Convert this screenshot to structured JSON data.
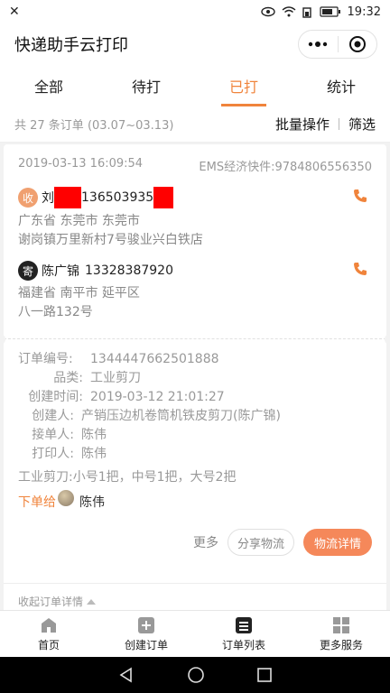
{
  "statusbar": {
    "time": "19:32"
  },
  "app": {
    "title": "快递助手云打印"
  },
  "tabs": [
    {
      "label": "全部"
    },
    {
      "label": "待打"
    },
    {
      "label": "已打"
    },
    {
      "label": "统计"
    }
  ],
  "active_tab": "已打",
  "summary": {
    "count": "共 27 条订单 (03.07~03.13)",
    "batch": "批量操作",
    "filter": "筛选"
  },
  "order": {
    "time": "2019-03-13 16:09:54",
    "tracking": "EMS经济快件:9784806556350",
    "receiver": {
      "badge": "收",
      "name": "刘",
      "phone": "136503935",
      "addr1": "广东省 东莞市 东莞市",
      "addr2": "谢岗镇万里新村7号骏业兴白铁店"
    },
    "sender": {
      "badge": "寄",
      "name": "陈广锦",
      "phone": "13328387920",
      "addr1": "福建省 南平市 延平区",
      "addr2": "八一路132号"
    },
    "details": {
      "order_no_label": "订单编号:",
      "order_no": "1344447662501888",
      "category_label": "品类:",
      "category": "工业剪刀",
      "created_label": "创建时间:",
      "created": "2019-03-12 21:01:27",
      "creator_label": "创建人:",
      "creator": "产销压边机卷筒机铁皮剪刀(陈广锦)",
      "receiver_label": "接单人:",
      "receiver": "陈伟",
      "printer_label": "打印人:",
      "printer": "陈伟"
    },
    "note": "工业剪刀:小号1把，中号1把，大号2把",
    "assign_label": "下单给",
    "assign_name": "陈伟",
    "more": "更多",
    "share": "分享物流",
    "logistics": "物流详情",
    "collapse": "收起订单详情"
  },
  "nav": [
    {
      "label": "首页",
      "icon": "home-icon"
    },
    {
      "label": "创建订单",
      "icon": "add-order-icon"
    },
    {
      "label": "订单列表",
      "icon": "order-list-icon"
    },
    {
      "label": "更多服务",
      "icon": "grid-icon"
    }
  ],
  "colors": {
    "accent": "#f0843c",
    "button": "#f5885a",
    "redaction": "#ff0000"
  }
}
